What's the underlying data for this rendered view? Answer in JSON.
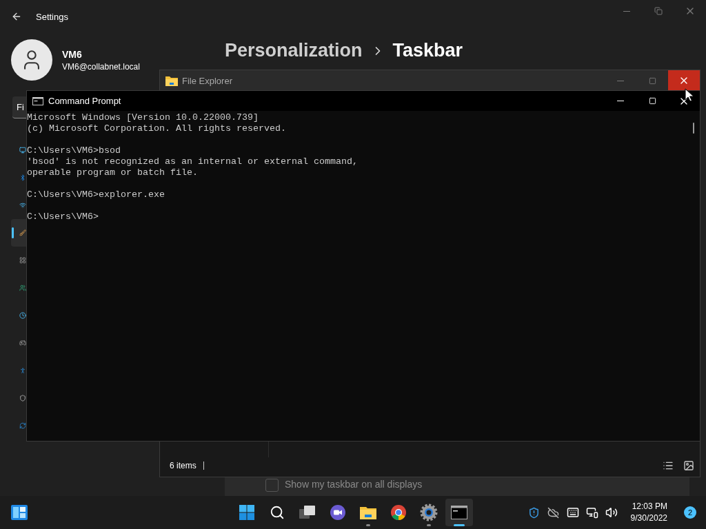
{
  "settings": {
    "title": "Settings",
    "user": {
      "name": "VM6",
      "email": "VM6@collabnet.local"
    },
    "search": {
      "value": "Fi"
    },
    "nav_items": [
      {
        "selected": false
      },
      {
        "selected": false
      },
      {
        "selected": false
      },
      {
        "selected": true
      },
      {
        "selected": false
      },
      {
        "selected": false
      },
      {
        "selected": false
      },
      {
        "selected": false
      },
      {
        "selected": false
      },
      {
        "selected": false
      },
      {
        "selected": false
      }
    ],
    "breadcrumb": [
      "Personalization",
      "Taskbar"
    ],
    "option": {
      "label": "Show my taskbar on all displays",
      "checked": false,
      "disabled": true
    }
  },
  "file_explorer": {
    "title": "File Explorer",
    "status": "6 items",
    "close_hovered": true
  },
  "command_prompt": {
    "title": "Command Prompt",
    "blocks": [
      [
        "Microsoft Windows [Version 10.0.22000.739]",
        "(c) Microsoft Corporation. All rights reserved."
      ],
      [
        "C:\\Users\\VM6>bsod",
        "'bsod' is not recognized as an internal or external command,",
        "operable program or batch file."
      ],
      [
        "C:\\Users\\VM6>explorer.exe"
      ],
      [
        "C:\\Users\\VM6>"
      ]
    ]
  },
  "taskbar": {
    "apps": [
      {
        "kind": "start",
        "running": false,
        "selected": false
      },
      {
        "kind": "search",
        "running": false,
        "selected": false
      },
      {
        "kind": "taskview",
        "running": false,
        "selected": false
      },
      {
        "kind": "chat",
        "running": false,
        "selected": false
      },
      {
        "kind": "explorer",
        "running": true,
        "selected": false
      },
      {
        "kind": "browser",
        "running": false,
        "selected": false
      },
      {
        "kind": "settings",
        "running": true,
        "selected": false
      },
      {
        "kind": "terminal",
        "running": true,
        "selected": true
      }
    ],
    "time": "12:03 PM",
    "date": "9/30/2022",
    "notifications": "2"
  }
}
